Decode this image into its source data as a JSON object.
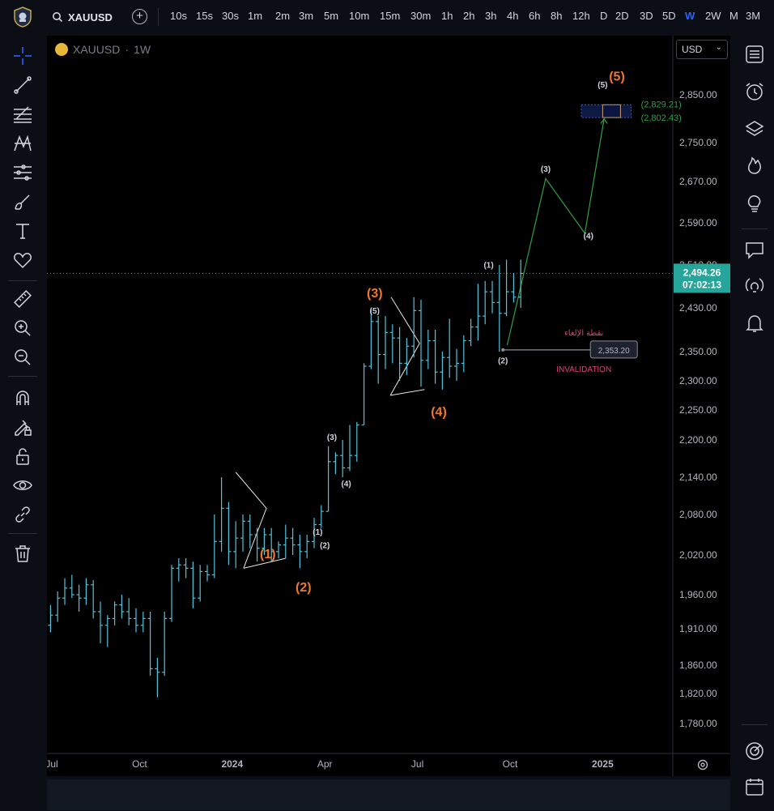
{
  "toolbar": {
    "symbol": "XAUUSD",
    "intervals": [
      "10s",
      "15s",
      "30s",
      "1m",
      "2m",
      "3m",
      "5m",
      "10m",
      "15m",
      "30m",
      "1h",
      "2h",
      "3h",
      "4h",
      "6h",
      "8h",
      "12h",
      "D",
      "2D",
      "3D",
      "5D",
      "W",
      "2W",
      "M",
      "3M"
    ],
    "active_interval": "W"
  },
  "legend": {
    "symbol": "XAUUSD",
    "sep": "·",
    "interval": "1W"
  },
  "currency": {
    "label": "USD"
  },
  "price_axis": {
    "ticks": [
      2850,
      2750,
      2670,
      2590,
      2510,
      2430,
      2350,
      2300,
      2250,
      2200,
      2140,
      2080,
      2020,
      1960,
      1910,
      1860,
      1820,
      1780
    ],
    "tick_labels": [
      "2,850.00",
      "2,750.00",
      "2,670.00",
      "2,590.00",
      "2,510.00",
      "2,430.00",
      "2,350.00",
      "2,300.00",
      "2,250.00",
      "2,200.00",
      "2,140.00",
      "2,080.00",
      "2,020.00",
      "1,960.00",
      "1,910.00",
      "1,860.00",
      "1,820.00",
      "1,780.00"
    ],
    "current_price": "2,494.26",
    "countdown": "07:02:13",
    "current_price_value": 2494.26,
    "accent_color": "#26a69a"
  },
  "time_axis": {
    "labels": [
      {
        "text": "Jul",
        "bold": false,
        "week": 0
      },
      {
        "text": "Oct",
        "bold": false,
        "week": 13
      },
      {
        "text": "2024",
        "bold": true,
        "week": 26
      },
      {
        "text": "Apr",
        "bold": false,
        "week": 39
      },
      {
        "text": "Jul",
        "bold": false,
        "week": 52
      },
      {
        "text": "Oct",
        "bold": false,
        "week": 65
      },
      {
        "text": "2025",
        "bold": true,
        "week": 78
      }
    ]
  },
  "chart_data": {
    "type": "ohlc",
    "interval": "1W",
    "bar_color": "#4fc3dc",
    "bars": [
      [
        1915,
        1945,
        1905,
        1930
      ],
      [
        1930,
        1965,
        1920,
        1955
      ],
      [
        1955,
        1985,
        1945,
        1970
      ],
      [
        1970,
        1990,
        1955,
        1960
      ],
      [
        1960,
        1975,
        1935,
        1955
      ],
      [
        1955,
        1985,
        1945,
        1975
      ],
      [
        1975,
        1982,
        1925,
        1935
      ],
      [
        1935,
        1950,
        1890,
        1915
      ],
      [
        1915,
        1930,
        1885,
        1925
      ],
      [
        1925,
        1950,
        1915,
        1945
      ],
      [
        1945,
        1960,
        1925,
        1935
      ],
      [
        1935,
        1955,
        1915,
        1925
      ],
      [
        1925,
        1940,
        1905,
        1915
      ],
      [
        1915,
        1935,
        1905,
        1925
      ],
      [
        1925,
        1935,
        1845,
        1855
      ],
      [
        1855,
        1870,
        1815,
        1850
      ],
      [
        1850,
        1935,
        1845,
        1925
      ],
      [
        1925,
        2005,
        1920,
        2000
      ],
      [
        2000,
        2015,
        1980,
        2005
      ],
      [
        2005,
        2015,
        1985,
        2000
      ],
      [
        2000,
        2010,
        1940,
        1955
      ],
      [
        1955,
        2005,
        1950,
        1995
      ],
      [
        1995,
        2005,
        1980,
        1990
      ],
      [
        1990,
        2080,
        1985,
        2040
      ],
      [
        2040,
        2140,
        2025,
        2090
      ],
      [
        2090,
        2100,
        2005,
        2025
      ],
      [
        2025,
        2070,
        2000,
        2045
      ],
      [
        2045,
        2080,
        2025,
        2070
      ],
      [
        2070,
        2080,
        2030,
        2050
      ],
      [
        2050,
        2060,
        2010,
        2030
      ],
      [
        2030,
        2060,
        2020,
        2050
      ],
      [
        2050,
        2060,
        2010,
        2025
      ],
      [
        2025,
        2040,
        2015,
        2035
      ],
      [
        2035,
        2065,
        2015,
        2045
      ],
      [
        2045,
        2060,
        2020,
        2035
      ],
      [
        2035,
        2050,
        2000,
        2025
      ],
      [
        2025,
        2050,
        2015,
        2040
      ],
      [
        2040,
        2075,
        2030,
        2065
      ],
      [
        2065,
        2095,
        2060,
        2085
      ],
      [
        2085,
        2190,
        2085,
        2165
      ],
      [
        2165,
        2180,
        2145,
        2175
      ],
      [
        2175,
        2200,
        2140,
        2155
      ],
      [
        2155,
        2225,
        2150,
        2175
      ],
      [
        2175,
        2230,
        2165,
        2225
      ],
      [
        2225,
        2330,
        2225,
        2325
      ],
      [
        2325,
        2430,
        2320,
        2405
      ],
      [
        2405,
        2415,
        2295,
        2345
      ],
      [
        2345,
        2415,
        2320,
        2385
      ],
      [
        2385,
        2400,
        2330,
        2375
      ],
      [
        2375,
        2395,
        2300,
        2330
      ],
      [
        2330,
        2375,
        2310,
        2360
      ],
      [
        2360,
        2450,
        2340,
        2425
      ],
      [
        2425,
        2445,
        2290,
        2335
      ],
      [
        2335,
        2390,
        2320,
        2370
      ],
      [
        2370,
        2390,
        2295,
        2315
      ],
      [
        2315,
        2350,
        2285,
        2340
      ],
      [
        2340,
        2410,
        2305,
        2325
      ],
      [
        2325,
        2355,
        2300,
        2330
      ],
      [
        2330,
        2380,
        2315,
        2370
      ],
      [
        2370,
        2410,
        2360,
        2395
      ],
      [
        2395,
        2475,
        2370,
        2415
      ],
      [
        2415,
        2480,
        2400,
        2460
      ],
      [
        2460,
        2480,
        2420,
        2440
      ],
      [
        2440,
        2510,
        2350,
        2420
      ],
      [
        2420,
        2520,
        2415,
        2460
      ],
      [
        2460,
        2495,
        2440,
        2450
      ],
      [
        2450,
        2520,
        2430,
        2494.26
      ]
    ],
    "ylim": [
      1750,
      2900
    ],
    "wave_labels": [
      {
        "text": "(1)",
        "degree": "primary",
        "week": 31,
        "price": 2015,
        "below": false
      },
      {
        "text": "(2)",
        "degree": "primary",
        "week": 36,
        "price": 1965,
        "below": true
      },
      {
        "text": "(3)",
        "degree": "primary",
        "week": 46,
        "price": 2450,
        "below": false
      },
      {
        "text": "(4)",
        "degree": "primary",
        "week": 55,
        "price": 2240,
        "below": true
      },
      {
        "text": "(5)",
        "degree": "primary",
        "week": 80,
        "price": 2880,
        "below": false
      },
      {
        "text": "(1)",
        "degree": "minor",
        "week": 38,
        "price": 2050,
        "below": false
      },
      {
        "text": "(2)",
        "degree": "minor",
        "week": 39,
        "price": 2030,
        "below": true
      },
      {
        "text": "(3)",
        "degree": "minor",
        "week": 40,
        "price": 2200,
        "below": false
      },
      {
        "text": "(4)",
        "degree": "minor",
        "week": 42,
        "price": 2125,
        "below": true
      },
      {
        "text": "(5)",
        "degree": "minor",
        "week": 46,
        "price": 2420,
        "below": false
      },
      {
        "text": "(1)",
        "degree": "minor",
        "week": 62,
        "price": 2505,
        "below": false
      },
      {
        "text": "(2)",
        "degree": "minor",
        "week": 64,
        "price": 2330,
        "below": true
      },
      {
        "text": "(3)",
        "degree": "minor",
        "week": 70,
        "price": 2690,
        "below": false
      },
      {
        "text": "(4)",
        "degree": "minor",
        "week": 76,
        "price": 2560,
        "below": true
      },
      {
        "text": "(5)",
        "degree": "minor",
        "week": 78,
        "price": 2865,
        "below": false
      }
    ],
    "projection_path": [
      {
        "week": 64.6,
        "price": 2362
      },
      {
        "week": 70,
        "price": 2676
      },
      {
        "week": 75.5,
        "price": 2570
      },
      {
        "week": 78.2,
        "price": 2800
      }
    ],
    "triangles": [
      {
        "points": [
          {
            "week": 26.5,
            "price": 2148
          },
          {
            "week": 30.8,
            "price": 2090
          },
          {
            "week": 27.6,
            "price": 2000
          }
        ],
        "side": [
          {
            "week": 27.6,
            "price": 2000
          },
          {
            "week": 33.5,
            "price": 2015
          }
        ]
      },
      {
        "points": [
          {
            "week": 48.3,
            "price": 2450
          },
          {
            "week": 52.3,
            "price": 2365
          },
          {
            "week": 48.2,
            "price": 2275
          }
        ],
        "side": [
          {
            "week": 48.2,
            "price": 2275
          },
          {
            "week": 53,
            "price": 2285
          }
        ]
      }
    ],
    "target_zone": {
      "top": 2829.21,
      "bottom": 2802.43,
      "top_label": "(2,829.21)",
      "bottom_label": "(2,802.43)",
      "week_from": 75,
      "week_to": 82,
      "inner_from": 78,
      "inner_to": 80.5
    },
    "invalidation": {
      "price": 2353.2,
      "price_label": "2,353.20",
      "label": "INVALIDATION",
      "label_ar": "نقطة الإلغاء",
      "week_from": 64,
      "week_to": 76.5,
      "color": "#e0407a"
    },
    "colors": {
      "projection": "#2ea043",
      "primary_wave": "#f0782a",
      "minor_wave": "#d1d4dc",
      "target_border": "#3a5bd9",
      "target_fill": "#1c2f7a",
      "target_text": "#2ea043"
    }
  },
  "left_tools": [
    "crosshair-icon",
    "trend-line-icon",
    "fib-retracement-icon",
    "pattern-icon",
    "prediction-icon",
    "brush-icon",
    "text-icon",
    "heart-icon",
    "ruler-icon",
    "zoom-in-icon",
    "zoom-out-icon",
    "magnet-icon",
    "lock-edit-icon",
    "unlock-icon",
    "eye-icon",
    "link-icon",
    "trash-icon"
  ],
  "right_tools": [
    "watchlist-icon",
    "alarm-icon",
    "layers-icon",
    "flame-icon",
    "bulb-icon",
    "chat-icon",
    "broadcast-icon",
    "bell-icon",
    "target-icon",
    "calendar-icon"
  ]
}
